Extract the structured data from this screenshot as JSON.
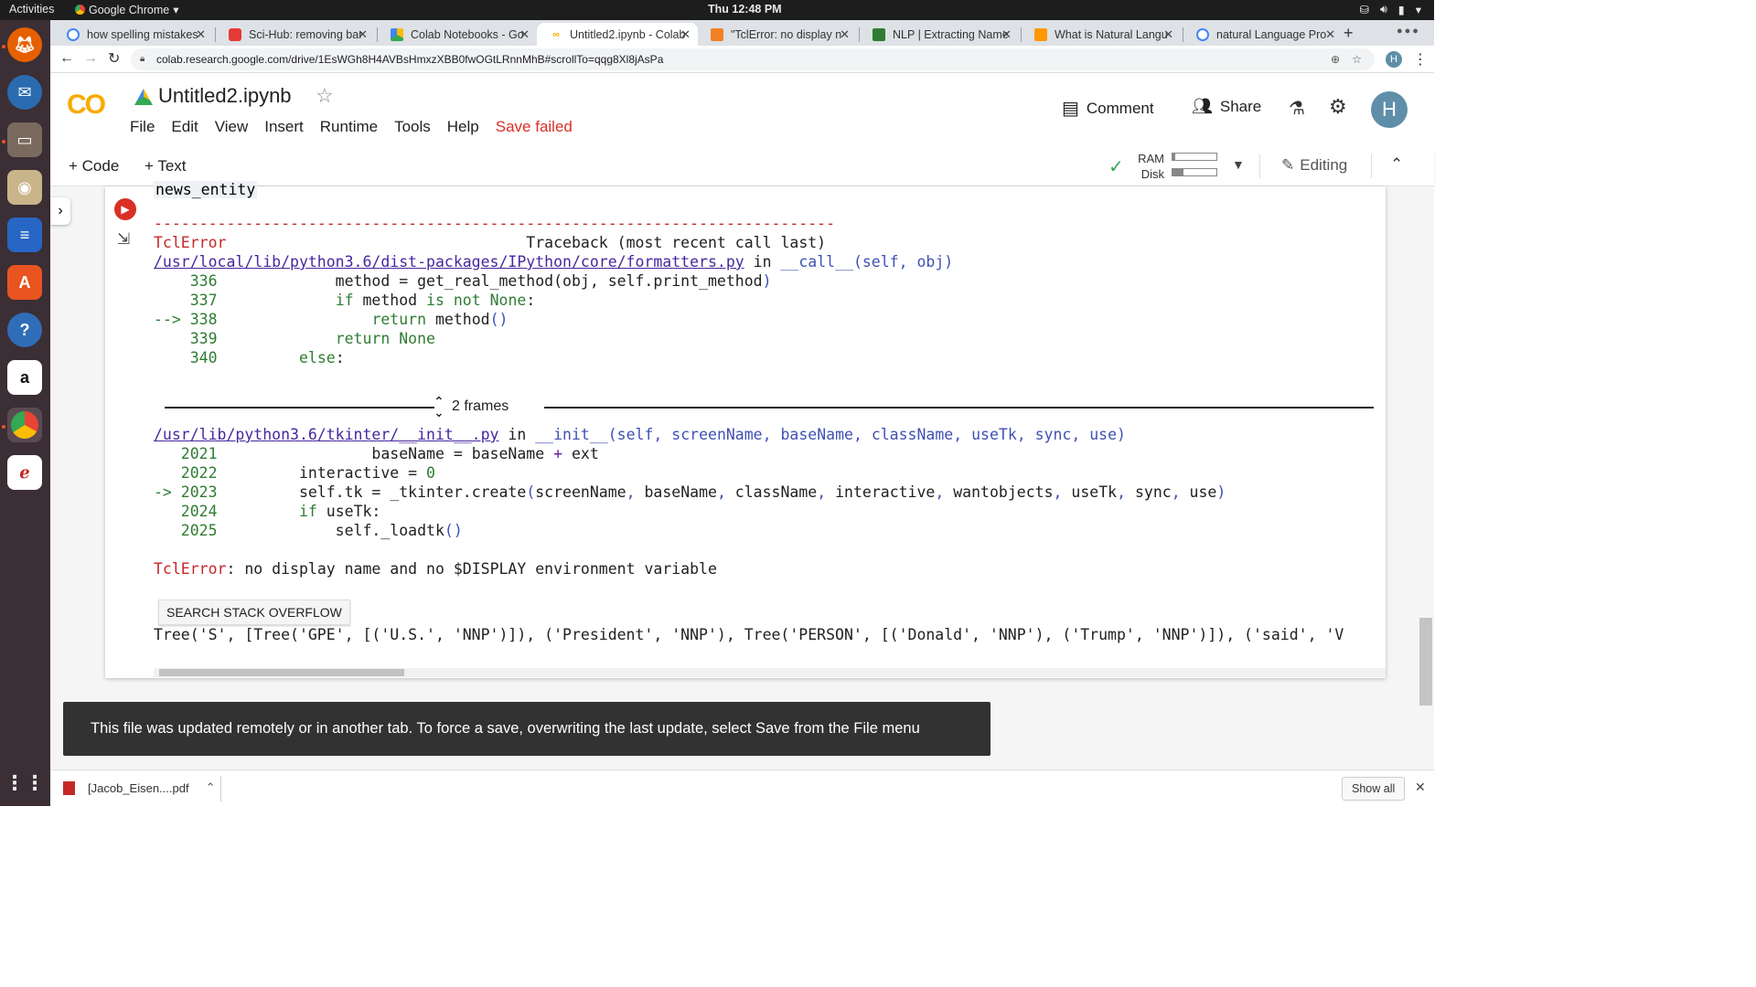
{
  "os": {
    "activities": "Activities",
    "app_menu": "Google Chrome",
    "clock": "Thu 12:48 PM"
  },
  "tabs": [
    {
      "title": "how spelling mistakes",
      "icon": "google-icon"
    },
    {
      "title": "Sci-Hub: removing bar",
      "icon": "scihub-icon"
    },
    {
      "title": "Colab Notebooks - Go",
      "icon": "drive-icon"
    },
    {
      "title": "Untitled2.ipynb - Colab",
      "icon": "colab-icon",
      "active": true
    },
    {
      "title": "\"TclError: no display n",
      "icon": "stackoverflow-icon"
    },
    {
      "title": "NLP | Extracting Name",
      "icon": "site-icon"
    },
    {
      "title": "What is Natural Langu",
      "icon": "site-icon"
    },
    {
      "title": "natural Language Pro",
      "icon": "google-icon"
    }
  ],
  "address": {
    "url": "colab.research.google.com/drive/1EsWGh8H4AVBsHmxzXBB0fwOGtLRnnMhB#scrollTo=qqg8Xl8jAsPa"
  },
  "colab": {
    "logo": "CO",
    "title": "Untitled2.ipynb",
    "menus": [
      "File",
      "Edit",
      "View",
      "Insert",
      "Runtime",
      "Tools",
      "Help"
    ],
    "save_status": "Save failed",
    "comment": "Comment",
    "share": "Share",
    "avatar_letter": "H",
    "add_code": "+ Code",
    "add_text": "+ Text",
    "ram_label": "RAM",
    "disk_label": "Disk",
    "editing": "Editing"
  },
  "cell": {
    "input_tail": "news_entity",
    "frames_label": "2 frames",
    "search_button": "SEARCH STACK OVERFLOW",
    "error_final": "TclError: no display name and no $DISPLAY environment variable",
    "tree_output": "Tree('S', [Tree('GPE', [('U.S.', 'NNP')]), ('President', 'NNP'), Tree('PERSON', [('Donald', 'NNP'), ('Trump', 'NNP')]), ('said', 'V"
  },
  "toast": {
    "message": "This file was updated remotely or in another tab. To force a save, overwriting the last update, select Save from the File menu"
  },
  "downloads": {
    "file": "[Jacob_Eisen....pdf",
    "show_all": "Show all"
  },
  "colors": {
    "error_red": "#c62828",
    "colab_orange": "#f9ab00",
    "save_failed": "#d93025"
  }
}
